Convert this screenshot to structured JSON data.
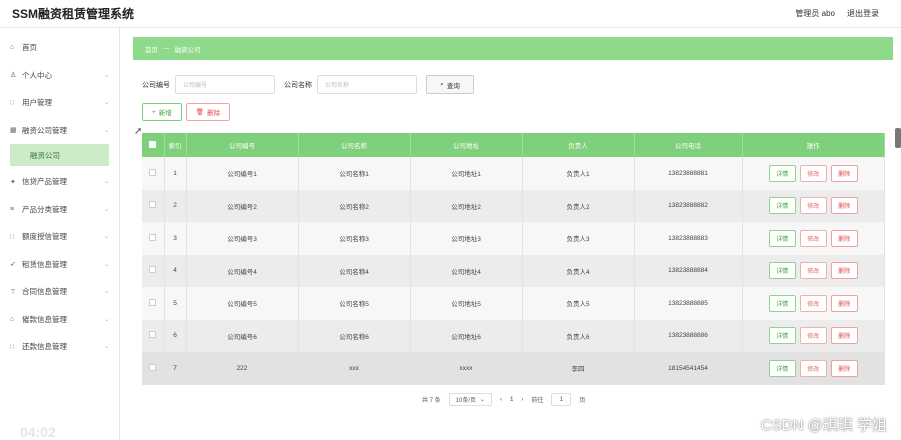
{
  "app": {
    "title": "SSM融资租赁管理系统",
    "user": "管理员 abo",
    "logout": "退出登录"
  },
  "sidebar": {
    "items": [
      {
        "label": "首页",
        "icon": "home-icon",
        "glyph": "⌂",
        "chevron": false
      },
      {
        "label": "个人中心",
        "icon": "user-icon",
        "glyph": "♙",
        "chevron": true
      },
      {
        "label": "用户管理",
        "icon": "grid-icon",
        "glyph": "∷",
        "chevron": true
      },
      {
        "label": "融资公司管理",
        "icon": "building-icon",
        "glyph": "▦",
        "chevron": true
      },
      {
        "label": "信贷产品管理",
        "icon": "star-icon",
        "glyph": "✦",
        "chevron": true
      },
      {
        "label": "产品分类管理",
        "icon": "list-icon",
        "glyph": "≡",
        "chevron": true
      },
      {
        "label": "额度授信管理",
        "icon": "grid-icon",
        "glyph": "∷",
        "chevron": true
      },
      {
        "label": "租赁信息管理",
        "icon": "send-icon",
        "glyph": "➶",
        "chevron": true
      },
      {
        "label": "合同信息管理",
        "icon": "doc-icon",
        "glyph": "⊤",
        "chevron": true
      },
      {
        "label": "催款信息管理",
        "icon": "bank-icon",
        "glyph": "⌂",
        "chevron": true
      },
      {
        "label": "还款信息管理",
        "icon": "grid-icon",
        "glyph": "∷",
        "chevron": true
      }
    ],
    "active_sub": "融资公司"
  },
  "timestamp": "04:02",
  "breadcrumb": {
    "home": "首页",
    "sep": "—",
    "current": "融资公司"
  },
  "search": {
    "code_label": "公司编号",
    "code_placeholder": "公司编号",
    "name_label": "公司名称",
    "name_placeholder": "公司名称",
    "query_button": "查询"
  },
  "actions": {
    "add": "新增",
    "delete": "删除"
  },
  "table": {
    "headers": [
      "索引",
      "公司编号",
      "公司名称",
      "公司地址",
      "负责人",
      "公司电话",
      "操作"
    ],
    "rows": [
      {
        "idx": "1",
        "code": "公司编号1",
        "name": "公司名称1",
        "addr": "公司地址1",
        "person": "负责人1",
        "phone": "13823888881"
      },
      {
        "idx": "2",
        "code": "公司编号2",
        "name": "公司名称2",
        "addr": "公司地址2",
        "person": "负责人2",
        "phone": "13823888882"
      },
      {
        "idx": "3",
        "code": "公司编号3",
        "name": "公司名称3",
        "addr": "公司地址3",
        "person": "负责人3",
        "phone": "13823888883"
      },
      {
        "idx": "4",
        "code": "公司编号4",
        "name": "公司名称4",
        "addr": "公司地址4",
        "person": "负责人4",
        "phone": "13823888884"
      },
      {
        "idx": "5",
        "code": "公司编号5",
        "name": "公司名称5",
        "addr": "公司地址5",
        "person": "负责人5",
        "phone": "13823888885"
      },
      {
        "idx": "6",
        "code": "公司编号6",
        "name": "公司名称6",
        "addr": "公司地址6",
        "person": "负责人6",
        "phone": "13823888886"
      },
      {
        "idx": "7",
        "code": "222",
        "name": "xxx",
        "addr": "xxxx",
        "person": "李四",
        "phone": "18154541454"
      }
    ],
    "ops": {
      "detail": "详情",
      "edit": "修改",
      "remove": "删除"
    }
  },
  "pager": {
    "total": "共 7 条",
    "page_size": "10条/页",
    "current": "1",
    "goto_label": "前往",
    "goto_value": "1",
    "page_suffix": "页"
  },
  "watermark": "CSDN @琪琪 学姐",
  "colors": {
    "accent": "#7fd07b",
    "danger": "#e04a4a"
  }
}
